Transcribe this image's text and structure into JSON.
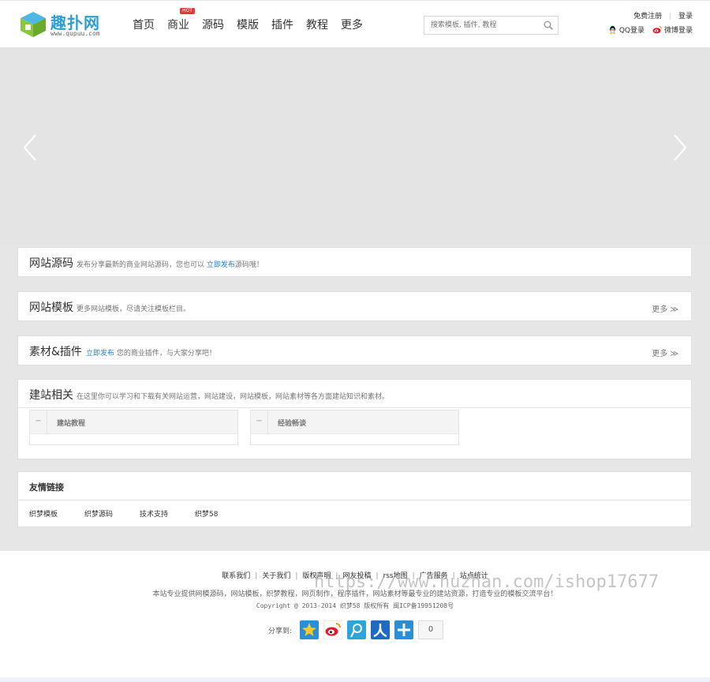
{
  "header": {
    "logo_name": "趣扑网",
    "logo_url": "www.qupuu.com",
    "nav": [
      {
        "label": "首页"
      },
      {
        "label": "商业",
        "badge": "HOT"
      },
      {
        "label": "源码"
      },
      {
        "label": "模版"
      },
      {
        "label": "插件"
      },
      {
        "label": "教程"
      },
      {
        "label": "更多"
      }
    ],
    "search_placeholder": "搜索模板, 插件, 教程",
    "register": "免费注册",
    "login": "登录",
    "qq_login": "QQ登录",
    "weibo_login": "微博登录"
  },
  "sections": {
    "source": {
      "title": "网站源码",
      "desc_pre": "发布分享最新的商业网站源码，您也可以",
      "desc_link": "立即发布",
      "desc_post": "源码哦！"
    },
    "template": {
      "title": "网站模板",
      "desc": "更多网站模板，尽请关注模板栏目。",
      "more": "更多 ≫"
    },
    "plugin": {
      "title": "素材&插件",
      "desc_link": "立即发布",
      "desc_post": "您的商业插件，与大家分享吧！",
      "more": "更多 ≫"
    },
    "related": {
      "title": "建站相关",
      "desc": "在这里你可以学习和下载有关网站运营，网站建设，网站模板，网站素材等各方面建站知识和素材。",
      "boxes": [
        {
          "toggle": "−",
          "title": "建站教程"
        },
        {
          "toggle": "−",
          "title": "经验畅谈"
        }
      ]
    }
  },
  "friends": {
    "title": "友情链接",
    "links": [
      "织梦模板",
      "织梦源码",
      "技术支持",
      "织梦58"
    ]
  },
  "footer": {
    "links": [
      "联系我们",
      "关于我们",
      "版权声明",
      "网友投稿",
      "rss地图",
      "广告服务",
      "站点统计"
    ],
    "text": "本站专业提供网模源码，网站模板，织梦教程，网页制作，程序插件，网站素材等最专业的建站资源，打造专业的模板交流平台！",
    "copyright": "Copyright  @  2013-2014  织梦58  版权所有  闽ICP备19951208号",
    "watermark": "https://www.huzhan.com/ishop17677",
    "share_label": "分享到:",
    "share_count": "0"
  },
  "colors": {
    "accent": "#2e9fd0",
    "hot": "#e4393c",
    "link": "#2e7fc4"
  }
}
